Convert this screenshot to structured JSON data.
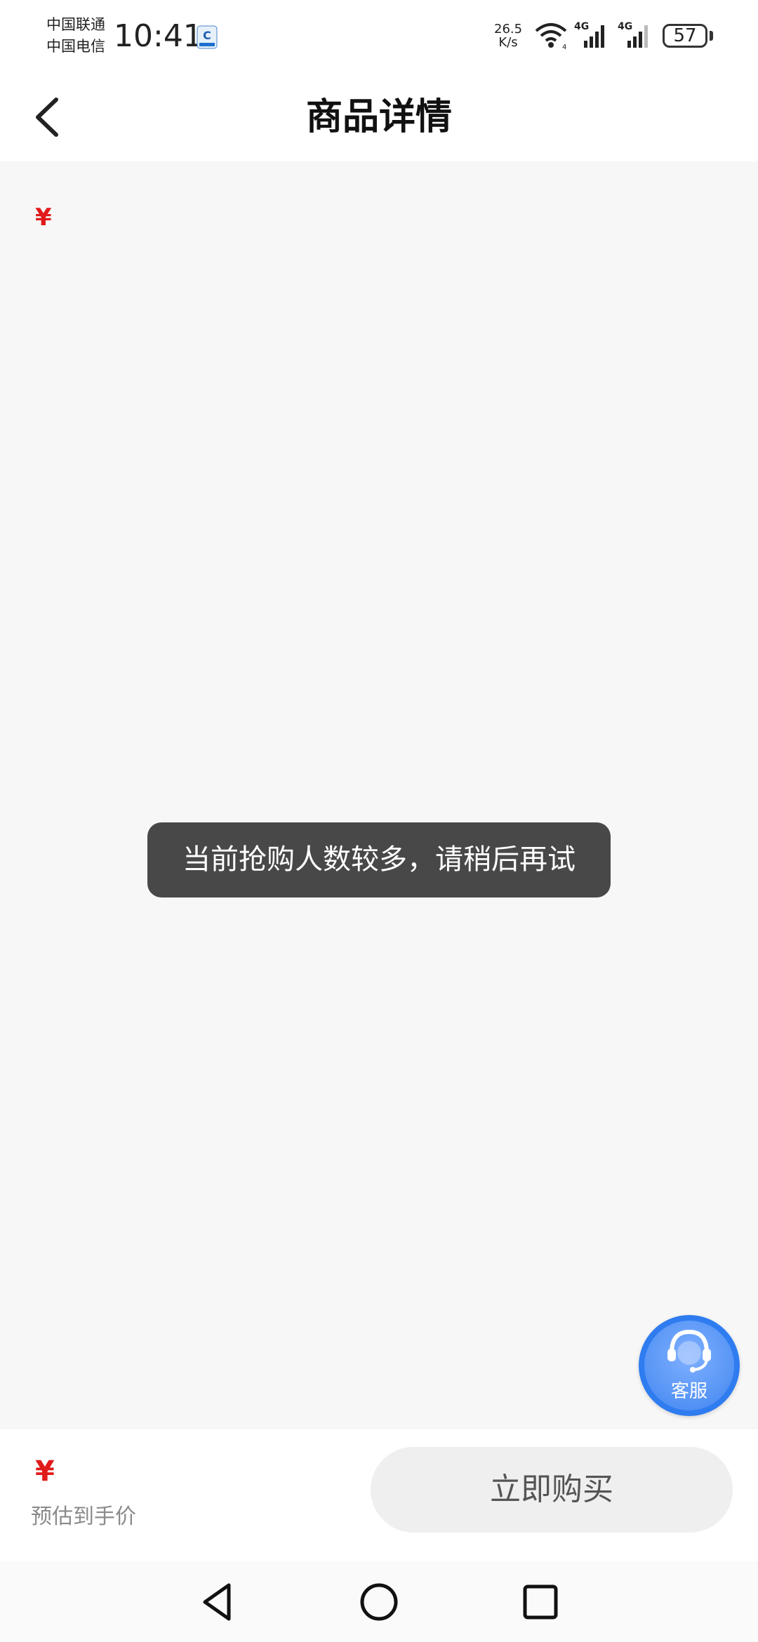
{
  "status_bar": {
    "carrier_1": "中国联通",
    "carrier_2": "中国电信",
    "time": "10:41",
    "net_speed_value": "26.5",
    "net_speed_unit": "K/s",
    "network_1": "4G",
    "network_2": "4G",
    "battery": "57"
  },
  "header": {
    "title": "商品详情"
  },
  "content": {
    "price_symbol": "¥"
  },
  "toast": {
    "message": "当前抢购人数较多，请稍后再试"
  },
  "customer_service": {
    "label": "客服"
  },
  "bottom_bar": {
    "price_symbol": "¥",
    "price_note": "预估到手价",
    "buy_label": "立即购买"
  },
  "icons": {
    "back": "chevron-left-icon",
    "wifi": "wifi-icon",
    "signal": "signal-icon",
    "battery": "battery-icon",
    "customer_service": "headset-icon",
    "nav_back": "triangle-back-icon",
    "nav_home": "circle-home-icon",
    "nav_recent": "square-recent-icon"
  },
  "colors": {
    "price": "#e11a1a",
    "cs_button": "#2f7cf0",
    "toast_bg": "#484848"
  }
}
